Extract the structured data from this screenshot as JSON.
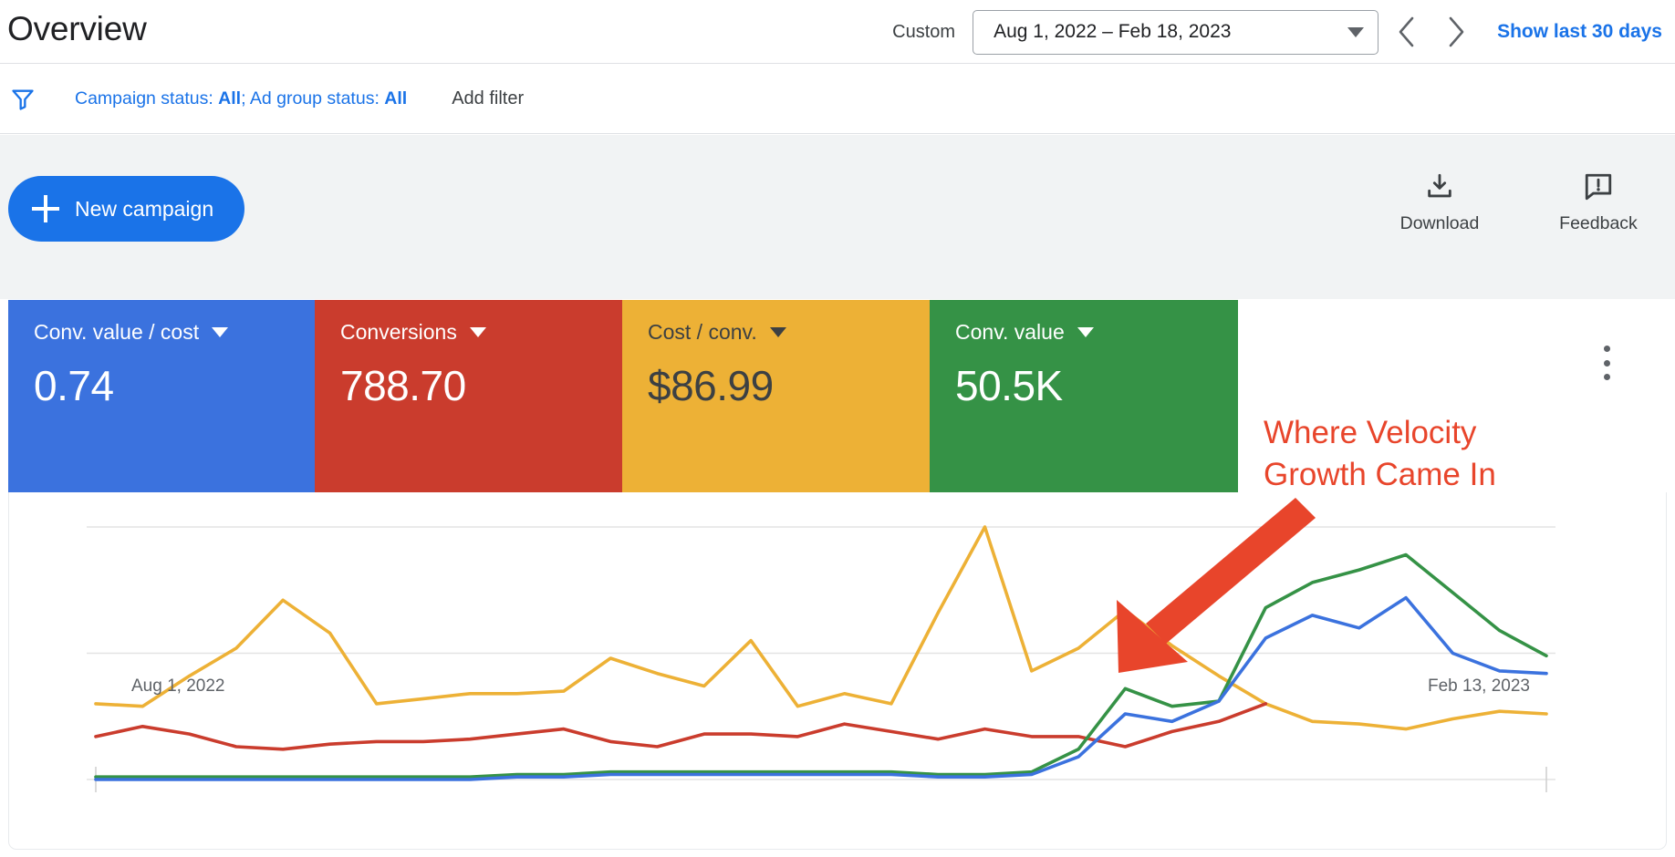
{
  "header": {
    "title": "Overview",
    "date_mode_label": "Custom",
    "date_range": "Aug 1, 2022 – Feb 18, 2023",
    "prev_arrow": "‹",
    "next_arrow": "›",
    "show_last_30": "Show last 30 days"
  },
  "filter_bar": {
    "filter_icon": "funnel-icon",
    "campaign_status_prefix": "Campaign status: ",
    "campaign_status_value": "All",
    "separator": "; ",
    "ad_group_status_prefix": "Ad group status: ",
    "ad_group_status_value": "All",
    "add_filter": "Add filter"
  },
  "action_strip": {
    "new_campaign": "New campaign",
    "download": "Download",
    "feedback": "Feedback"
  },
  "cards": [
    {
      "label": "Conv. value / cost",
      "value": "0.74",
      "bg": "#3b72de",
      "fg": "#ffffff"
    },
    {
      "label": "Conversions",
      "value": "788.70",
      "bg": "#ca3c2d",
      "fg": "#ffffff"
    },
    {
      "label": "Cost / conv.",
      "value": "$86.99",
      "bg": "#edb136",
      "fg": "#3c4043"
    },
    {
      "label": "Conv. value",
      "value": "50.5K",
      "bg": "#359246",
      "fg": "#ffffff"
    }
  ],
  "card_menu_icon": "more-vertical-icon",
  "annotation": {
    "line1": "Where Velocity",
    "line2": "Growth Came In",
    "color": "#e8452b",
    "arrow": "red-arrow-annotation"
  },
  "chart_data": {
    "type": "line",
    "title": "",
    "xlabel": "",
    "ylabel": "",
    "x_tick_labels": [
      "Aug 1, 2022",
      "Feb 13, 2023"
    ],
    "axis_range_start": "Aug 1, 2022",
    "axis_range_end": "Feb 13, 2023",
    "grid": true,
    "gridlines_y": [
      0,
      50,
      100
    ],
    "ylim": [
      0,
      100
    ],
    "legend_position": "metric-cards-above",
    "n_points": 29,
    "series": [
      {
        "name": "Cost / conv.",
        "color": "#edb136",
        "values": [
          30,
          29,
          41,
          52,
          71,
          58,
          30,
          32,
          34,
          34,
          35,
          48,
          42,
          37,
          55,
          29,
          34,
          30,
          66,
          100,
          43,
          52,
          67,
          53,
          41,
          30,
          23,
          22,
          20,
          24,
          27,
          26
        ]
      },
      {
        "name": "Conversions",
        "color": "#ca3c2d",
        "values": [
          17,
          21,
          18,
          13,
          12,
          14,
          15,
          15,
          16,
          18,
          20,
          15,
          13,
          18,
          18,
          17,
          22,
          19,
          16,
          20,
          17,
          17,
          13,
          19,
          23,
          30,
          null,
          null,
          null,
          null,
          null,
          null
        ]
      },
      {
        "name": "Conv. value",
        "color": "#359246",
        "values": [
          1,
          1,
          1,
          1,
          1,
          1,
          1,
          1,
          1,
          2,
          2,
          3,
          3,
          3,
          3,
          3,
          3,
          3,
          2,
          2,
          3,
          12,
          36,
          29,
          31,
          68,
          78,
          83,
          89,
          74,
          59,
          49
        ]
      },
      {
        "name": "Conv. value / cost",
        "color": "#3b72de",
        "values": [
          0,
          0,
          0,
          0,
          0,
          0,
          0,
          0,
          0,
          1,
          1,
          2,
          2,
          2,
          2,
          2,
          2,
          2,
          1,
          1,
          2,
          9,
          26,
          23,
          31,
          56,
          65,
          60,
          72,
          50,
          43,
          42
        ]
      }
    ]
  }
}
